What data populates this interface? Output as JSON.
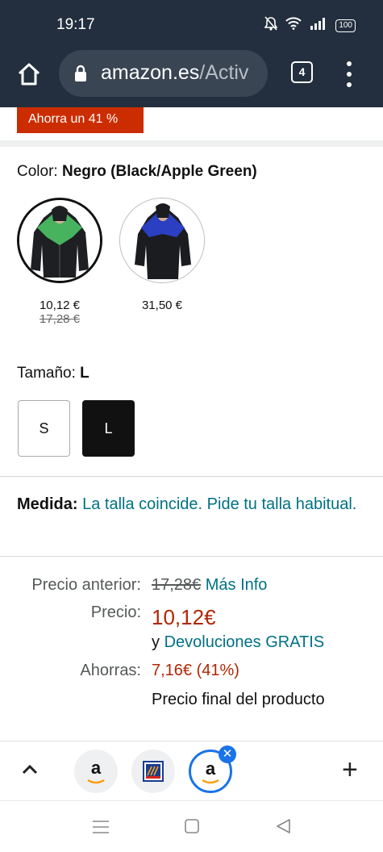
{
  "status_bar": {
    "time": "19:17",
    "battery": "100"
  },
  "browser": {
    "url_host": "amazon.es",
    "url_path": "/Activ",
    "tab_count": "4"
  },
  "product": {
    "savings_badge": "Ahorra un 41 %",
    "color_label": "Color: ",
    "color_value": "Negro (Black/Apple Green)",
    "swatches": [
      {
        "price": "10,12 €",
        "old_price": "17,28 €"
      },
      {
        "price": "31,50 €"
      }
    ],
    "size_label": "Tamaño: ",
    "size_value": "L",
    "sizes": [
      "S",
      "L"
    ],
    "fit_label": "Medida:",
    "fit_text": "La talla coincide. Pide tu talla habitual."
  },
  "pricing": {
    "list_price_label": "Precio anterior:",
    "list_price": "17,28€",
    "more_info": "Más Info",
    "price_label": "Precio:",
    "price": "10,12€",
    "returns_prefix": "y ",
    "returns_link": "Devoluciones GRATIS",
    "savings_label": "Ahorras:",
    "savings_value": "7,16€ (41%)",
    "final_price_note": "Precio final del producto"
  },
  "tab_strip": {
    "tabs": [
      {
        "logo": "a",
        "active": false
      },
      {
        "logo": "aldi",
        "active": false
      },
      {
        "logo": "a",
        "active": true
      }
    ]
  },
  "colors": {
    "header_bg": "#232f3e",
    "badge_red": "#cc2d00",
    "price_red": "#b12704",
    "link_teal": "#007185",
    "active_tab_blue": "#1a73e8"
  }
}
